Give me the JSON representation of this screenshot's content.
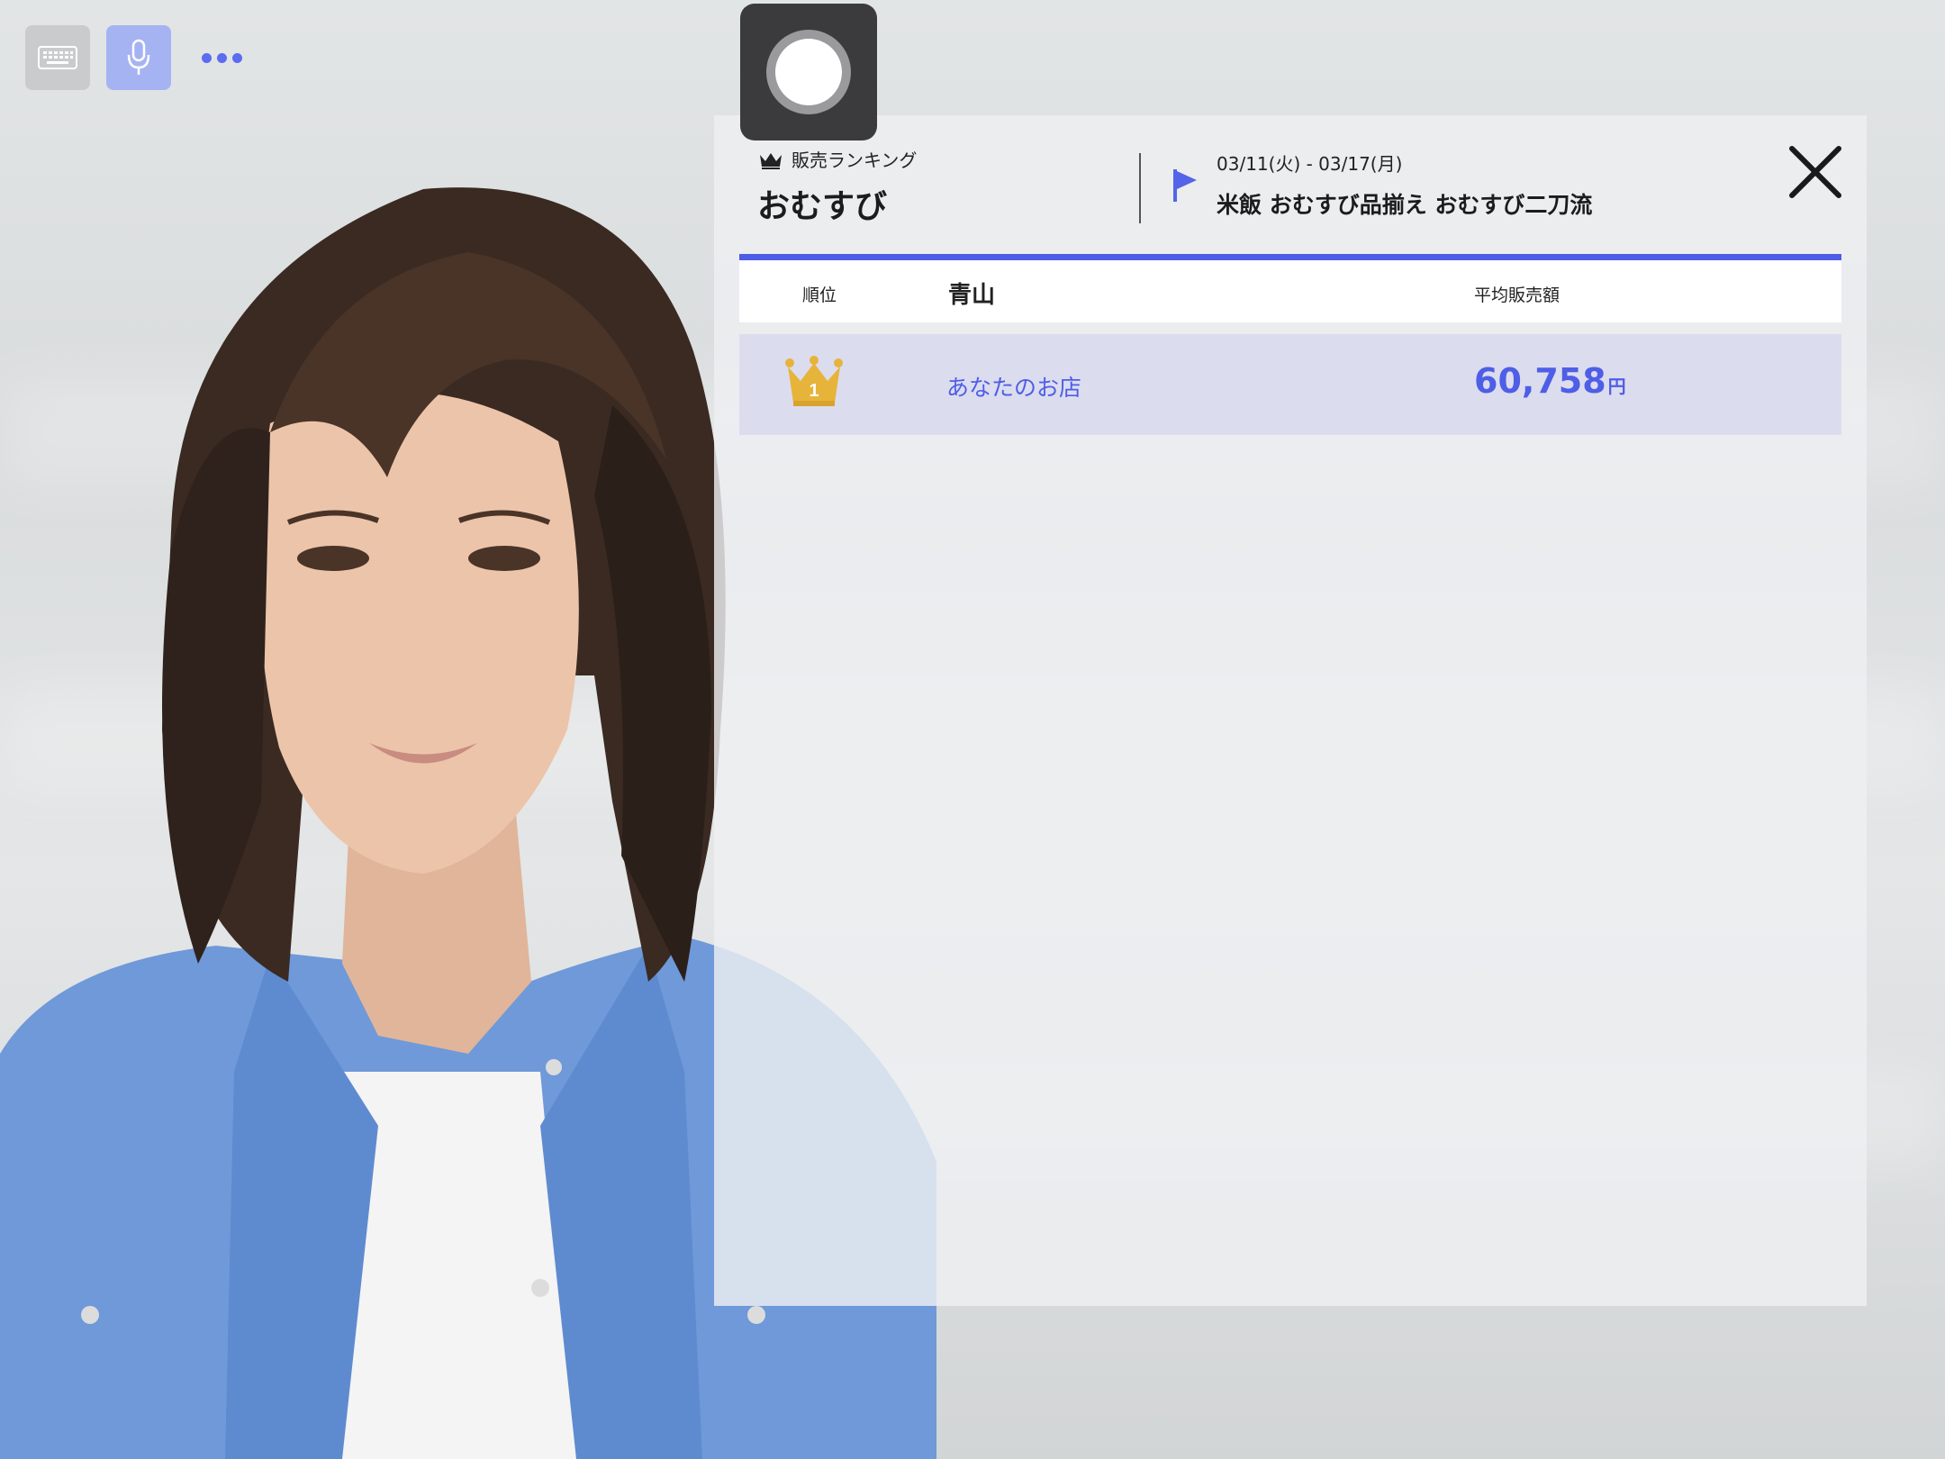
{
  "toolbar": {
    "keyboard_icon": "keyboard-icon",
    "mic_icon": "microphone-icon",
    "more_icon": "more-dots-icon"
  },
  "record": {
    "icon": "record-icon"
  },
  "panel": {
    "category_label": "販売ランキング",
    "product_title": "おむすび",
    "date_range": "03/11(火) - 03/17(月)",
    "tags": "米飯 おむすび品揃え おむすび二刀流",
    "close_icon": "close-icon"
  },
  "table": {
    "headers": {
      "rank": "順位",
      "region": "青山",
      "avg_sales": "平均販売額"
    },
    "rows": [
      {
        "rank": "1",
        "store": "あなたのお店",
        "amount": "60,758",
        "unit": "円"
      }
    ]
  },
  "colors": {
    "accent": "#4f5ce8",
    "highlight_row": "#dcdcef",
    "crown_gold": "#e6b43a",
    "mic_button": "#a6b3f3"
  }
}
